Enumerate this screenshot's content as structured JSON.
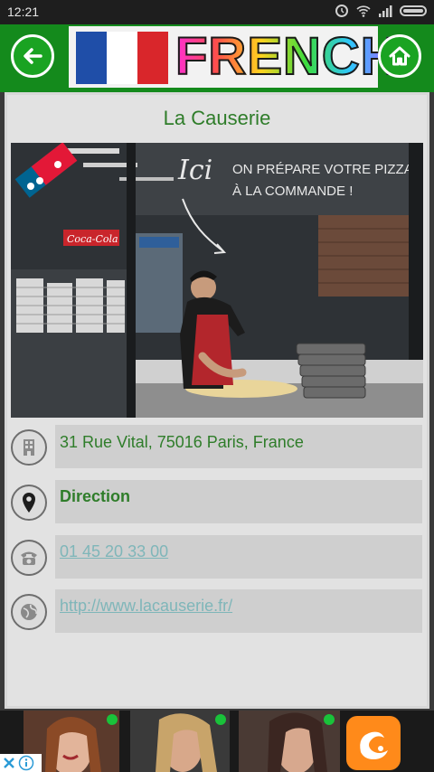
{
  "status_bar": {
    "time": "12:21"
  },
  "header": {
    "banner_text": "FRENCH",
    "flag_colors": [
      "#1f4ea8",
      "#ffffff",
      "#d9262b"
    ],
    "back_icon": "back-arrow-icon",
    "home_icon": "home-icon"
  },
  "restaurant": {
    "name": "La Causerie",
    "photo_sign_line1": "Ici",
    "photo_sign_line2": "ON PRÉPARE VOTRE PIZZA",
    "photo_sign_line3": "À LA COMMANDE !",
    "photo_fridge_text": "Coca-Cola"
  },
  "details": [
    {
      "icon": "building-icon",
      "text": "31 Rue Vital, 75016 Paris, France",
      "style": "plain"
    },
    {
      "icon": "location-pin-icon",
      "text": "Direction",
      "style": "bold"
    },
    {
      "icon": "phone-icon",
      "text": "01 45 20 33 00",
      "style": "link"
    },
    {
      "icon": "globe-icon",
      "text": "http://www.lacauserie.fr/",
      "style": "link"
    }
  ],
  "colors": {
    "brand_green": "#148a1c",
    "text_green": "#2f7d2a",
    "link_teal": "#7fb6b9"
  }
}
